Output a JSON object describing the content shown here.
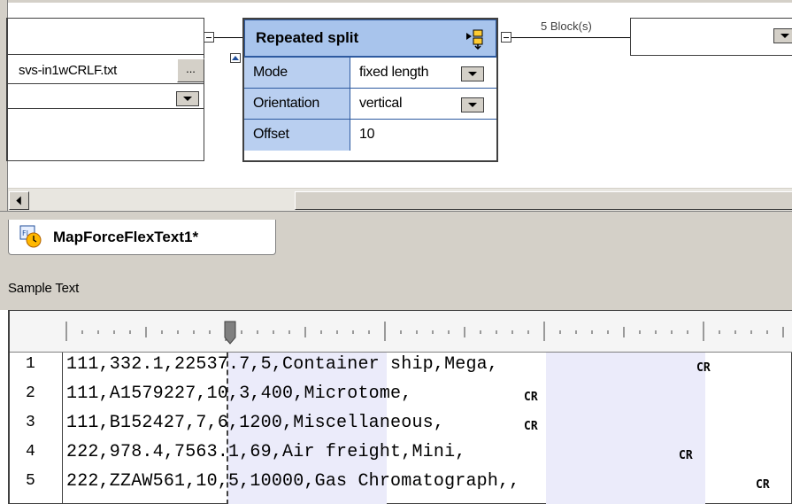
{
  "canvas": {
    "file_node": {
      "filename": "svs-in1wCRLF.txt",
      "browse_label": "..."
    },
    "split_node": {
      "title": "Repeated split",
      "properties": [
        {
          "name": "Mode",
          "value": "fixed length"
        },
        {
          "name": "Orientation",
          "value": "vertical"
        },
        {
          "name": "Offset",
          "value": "10"
        }
      ]
    },
    "block_label": "5 Block(s)"
  },
  "tab": {
    "label": "MapForceFlexText1*"
  },
  "sample": {
    "title": "Sample Text",
    "lines": [
      {
        "num": "1",
        "text": "111,332.1,22537.7,5,Container ship,Mega,"
      },
      {
        "num": "2",
        "text": "111,A1579227,10,3,400,Microtome,"
      },
      {
        "num": "3",
        "text": "111,B152427,7,6,1200,Miscellaneous,"
      },
      {
        "num": "4",
        "text": "222,978.4,7563.1,69,Air freight,Mini,"
      },
      {
        "num": "5",
        "text": "222,ZZAW561,10,5,10000,Gas Chromatograph,,"
      }
    ]
  },
  "colors": {
    "header_blue": "#a8c4ec",
    "property_blue": "#b9cff0",
    "shade": "#ebebfa"
  }
}
